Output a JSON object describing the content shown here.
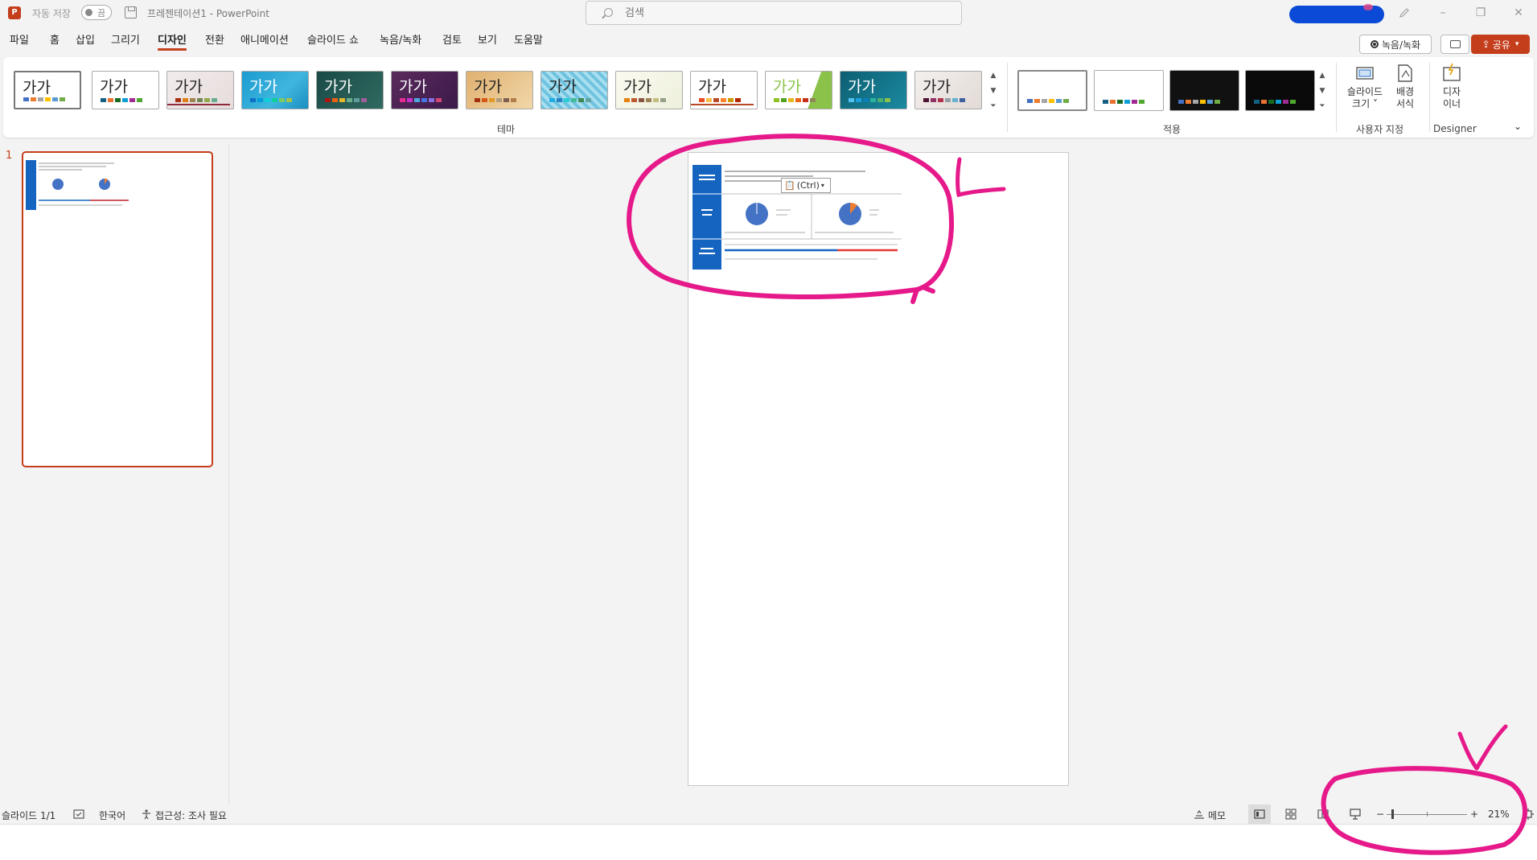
{
  "titlebar": {
    "app_logo": "P",
    "autosave_label": "자동 저장",
    "autosave_state": "끔",
    "document_title": "프레젠테이션1 - PowerPoint",
    "search_placeholder": "검색",
    "window_controls": [
      "–",
      "❐",
      "✕"
    ]
  },
  "menu": {
    "items": [
      "파일",
      "홈",
      "삽입",
      "그리기",
      "디자인",
      "전환",
      "애니메이션",
      "슬라이드 쇼",
      "녹음/녹화",
      "검토",
      "보기",
      "도움말"
    ],
    "active": "디자인",
    "record_label": "녹음/녹화",
    "share_label": "공유"
  },
  "ribbon": {
    "themes_group_label": "테마",
    "variants_group_label": "적용",
    "customize_group_label": "사용자 지정",
    "designer_group_label": "Designer",
    "theme_sample_text": "가가",
    "slide_size_label": [
      "슬라이드",
      "크기 ˅"
    ],
    "format_background_label": [
      "배경",
      "서식"
    ],
    "designer_label": [
      "디자",
      "이너"
    ],
    "colors": {
      "accent": "#c43e1c",
      "annotation": "#e6198a",
      "slide_blue": "#1565c0"
    }
  },
  "thumbnails": {
    "slide_number": "1"
  },
  "slide": {
    "paste_options_label": "(Ctrl)"
  },
  "statusbar": {
    "slide_info": "슬라이드 1/1",
    "language": "한국어",
    "accessibility": "접근성: 조사 필요",
    "notes_label": "메모",
    "zoom_minus": "−",
    "zoom_plus": "+",
    "zoom_level": "21%"
  }
}
